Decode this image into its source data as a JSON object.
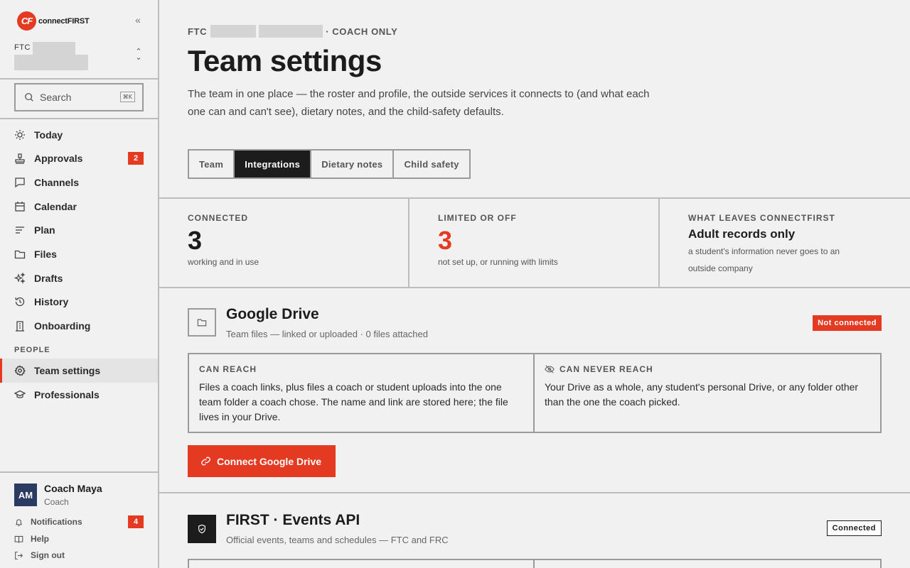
{
  "brand": {
    "logo_text": "CF",
    "name": "connectFIRST"
  },
  "team_switcher": {
    "prefix": "FTC"
  },
  "search": {
    "placeholder": "Search",
    "shortcut": "⌘K"
  },
  "nav": {
    "today": "Today",
    "approvals": "Approvals",
    "approvals_badge": "2",
    "channels": "Channels",
    "calendar": "Calendar",
    "plan": "Plan",
    "files": "Files",
    "drafts": "Drafts",
    "history": "History",
    "onboarding": "Onboarding",
    "people_label": "PEOPLE",
    "team_settings": "Team settings",
    "professionals": "Professionals"
  },
  "user": {
    "initials": "AM",
    "name": "Coach Maya",
    "role": "Coach"
  },
  "footer": {
    "notifications": "Notifications",
    "notifications_badge": "4",
    "help": "Help",
    "sign_out": "Sign out"
  },
  "header": {
    "crumb_prefix": "FTC",
    "crumb_suffix": "· COACH ONLY",
    "title": "Team settings",
    "description": "The team in one place — the roster and profile, the outside services it connects to (and what each one can and can't see), dietary notes, and the child-safety defaults."
  },
  "tabs": [
    {
      "label": "Team",
      "active": false
    },
    {
      "label": "Integrations",
      "active": true
    },
    {
      "label": "Dietary notes",
      "active": false
    },
    {
      "label": "Child safety",
      "active": false
    }
  ],
  "stats": {
    "connected": {
      "label": "CONNECTED",
      "value": "3",
      "sub": "working and in use"
    },
    "limited": {
      "label": "LIMITED OR OFF",
      "value": "3",
      "sub": "not set up, or running with limits"
    },
    "leaves": {
      "label": "WHAT LEAVES CONNECTFIRST",
      "headline": "Adult records only",
      "sub": "a student's information never goes to an outside company"
    }
  },
  "integrations": {
    "google_drive": {
      "title": "Google Drive",
      "subtitle": "Team files — linked or uploaded · 0 files attached",
      "status": "Not connected",
      "can_reach_label": "CAN REACH",
      "can_reach_text": "Files a coach links, plus files a coach or student uploads into the one team folder a coach chose. The name and link are stored here; the file lives in your Drive.",
      "never_reach_label": "CAN NEVER REACH",
      "never_reach_text": "Your Drive as a whole, any student's personal Drive, or any folder other than the one the coach picked.",
      "cta": "Connect Google Drive"
    },
    "first_events": {
      "title": "FIRST · Events API",
      "subtitle": "Official events, teams and schedules — FTC and FRC",
      "status": "Connected"
    }
  },
  "colors": {
    "accent": "#e53a22",
    "ink": "#1c1c1c",
    "avatar": "#2b3a60"
  }
}
